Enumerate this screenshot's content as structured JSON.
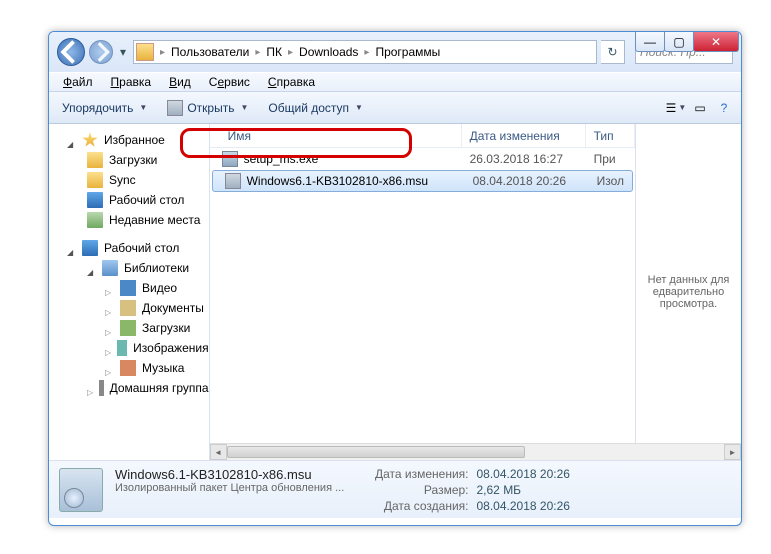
{
  "titlebar": {
    "min": "—",
    "max": "▢",
    "close": "✕"
  },
  "breadcrumbs": [
    "Пользователи",
    "ПК",
    "Downloads",
    "Программы"
  ],
  "search": {
    "placeholder": "Поиск: Пр..."
  },
  "menu": {
    "file": "Файл",
    "edit": "Правка",
    "view": "Вид",
    "tools": "Сервис",
    "help": "Справка"
  },
  "toolbar": {
    "organize": "Упорядочить",
    "open": "Открыть",
    "share": "Общий доступ"
  },
  "nav": {
    "favorites": "Избранное",
    "downloads": "Загрузки",
    "sync": "Sync",
    "desktop": "Рабочий стол",
    "recent": "Недавние места",
    "desktop2": "Рабочий стол",
    "libraries": "Библиотеки",
    "videos": "Видео",
    "documents": "Документы",
    "downloads2": "Загрузки",
    "images": "Изображения",
    "music": "Музыка",
    "homegroup": "Домашняя группа"
  },
  "columns": {
    "name": "Имя",
    "date": "Дата изменения",
    "type": "Тип"
  },
  "files": [
    {
      "name": "setup_ms.exe",
      "date": "26.03.2018 16:27",
      "type": "При"
    },
    {
      "name": "Windows6.1-KB3102810-x86.msu",
      "date": "08.04.2018 20:26",
      "type": "Изол"
    }
  ],
  "preview": "Нет данных для едварительно просмотра.",
  "details": {
    "name": "Windows6.1-KB3102810-x86.msu",
    "desc": "Изолированный пакет Центра обновления ...",
    "modLabel": "Дата изменения:",
    "modVal": "08.04.2018 20:26",
    "sizeLabel": "Размер:",
    "sizeVal": "2,62 МБ",
    "createdLabel": "Дата создания:",
    "createdVal": "08.04.2018 20:26"
  }
}
